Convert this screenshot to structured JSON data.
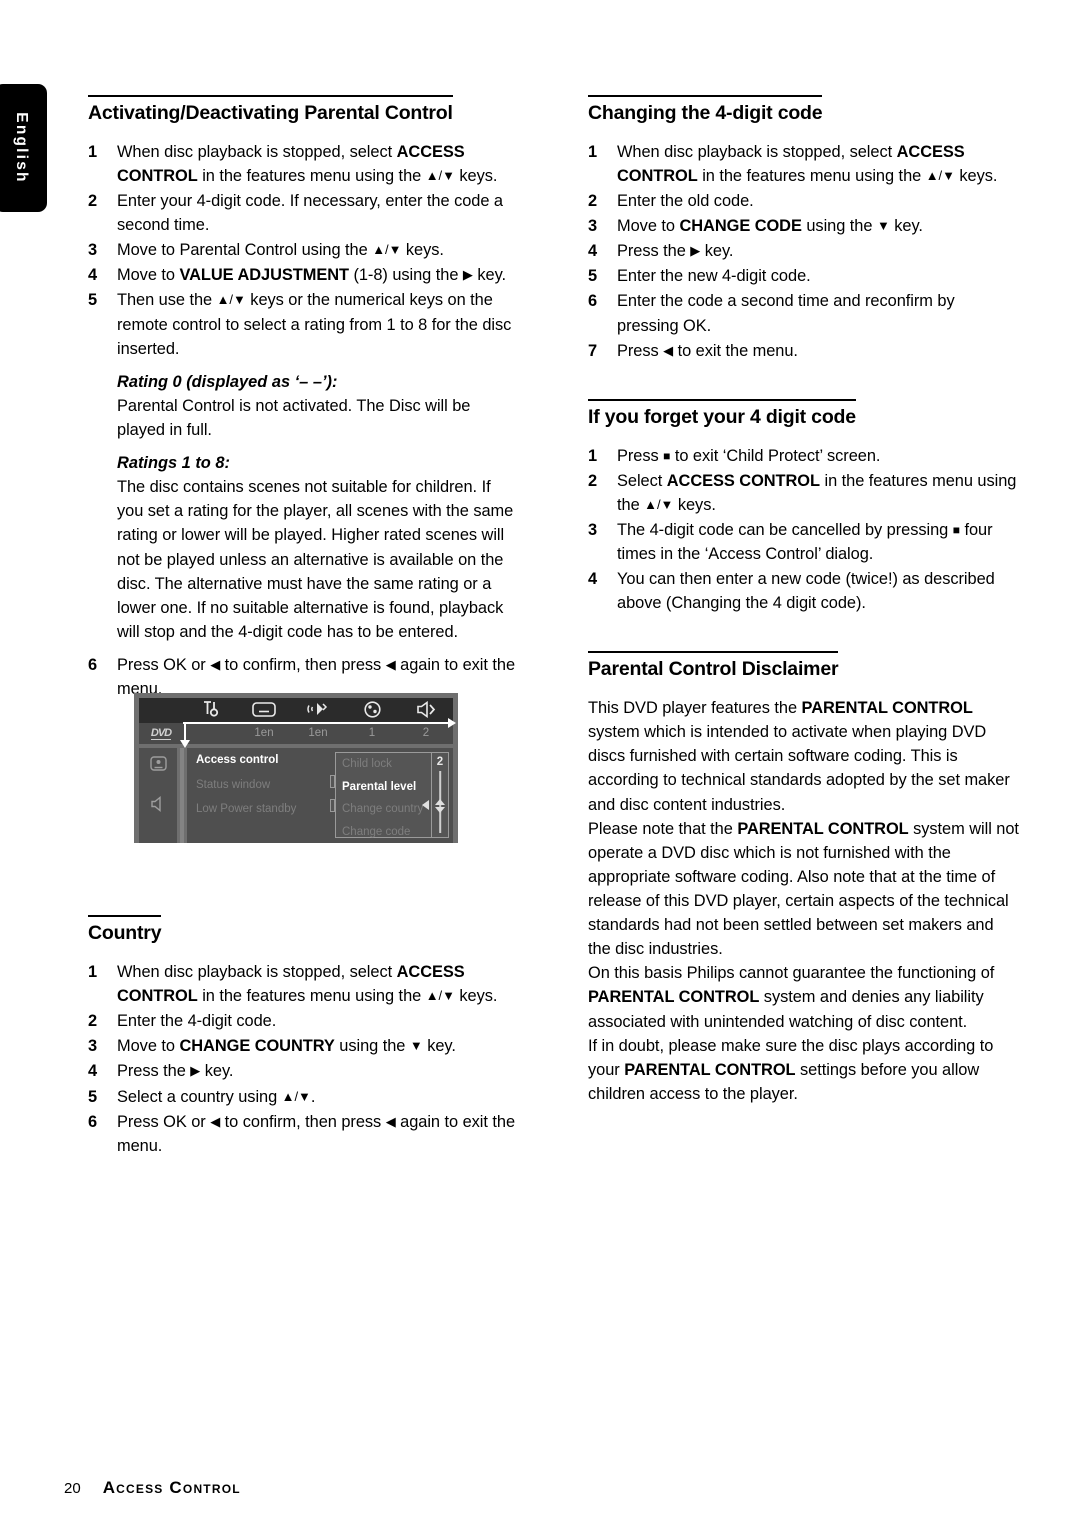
{
  "page": {
    "language_tab": "English",
    "footer_page_number": "20",
    "footer_title": "Access Control"
  },
  "left_column": {
    "section_parental": {
      "heading": "Activating/Deactivating Parental Control",
      "steps": [
        {
          "num": "1",
          "html": "When disc playback is stopped, select <b>ACCESS CONTROL</b> in the features menu using the <span class=\"kk\">▲/▼</span> keys."
        },
        {
          "num": "2",
          "html": "Enter your 4-digit code. If necessary, enter the code a second time."
        },
        {
          "num": "3",
          "html": "Move to Parental Control using the <span class=\"kk\">▲/▼</span> keys."
        },
        {
          "num": "4",
          "html": "Move to <b>VALUE ADJUSTMENT</b> (1-8) using the <span class=\"kk\">▶</span> key."
        },
        {
          "num": "5",
          "html": "Then use the <span class=\"kk\">▲/▼</span> keys or the numerical keys on the remote control to select a rating from 1 to 8 for the disc inserted."
        }
      ],
      "rating0_heading": "Rating 0 (displayed as ‘– –’):",
      "rating0_body": "Parental Control is not activated. The Disc will be played in full.",
      "ratings18_heading": "Ratings 1 to 8:",
      "ratings18_body": "The disc contains scenes not suitable for children. If you set a rating for the player, all scenes with the same rating or lower will be played. Higher rated scenes will not be played unless an alternative is available on the disc. The alternative must have the same rating or a lower one. If no suitable alternative is found, playback will stop and the 4-digit code has to be entered.",
      "final_step": {
        "num": "6",
        "html": "Press OK or <span class=\"kk\">◀</span> to confirm, then press <span class=\"kk\">◀</span> again to exit the menu."
      }
    },
    "tv_screenshot": {
      "top_bar": {
        "disc_label": "DVD",
        "items": [
          {
            "icon": "tools-icon",
            "value": ""
          },
          {
            "icon": "subtitle-icon",
            "value": "1en"
          },
          {
            "icon": "audio-language-icon",
            "value": "1en"
          },
          {
            "icon": "camera-angle-icon",
            "value": "1"
          },
          {
            "icon": "sound-icon",
            "value": "2"
          }
        ]
      },
      "sidebar_icons": [
        "picture-settings-icon",
        "speaker-icon"
      ],
      "menu_items": [
        {
          "label": "Access control",
          "selected": true
        },
        {
          "label": "Status window",
          "selected": false
        },
        {
          "label": "Low Power standby",
          "selected": false
        }
      ],
      "submenu_items": [
        {
          "label": "Child lock",
          "selected": false
        },
        {
          "label": "Parental level",
          "selected": true
        },
        {
          "label": "Change country",
          "selected": false
        },
        {
          "label": "Change code",
          "selected": false
        }
      ],
      "value": "2"
    },
    "section_country": {
      "heading": "Country",
      "steps": [
        {
          "num": "1",
          "html": "When disc playback is stopped, select <b>ACCESS CONTROL</b> in the features menu using the <span class=\"kk\">▲/▼</span> keys."
        },
        {
          "num": "2",
          "html": "Enter the 4-digit code."
        },
        {
          "num": "3",
          "html": "Move to <b>CHANGE COUNTRY</b> using the <span class=\"kk\">▼</span> key."
        },
        {
          "num": "4",
          "html": "Press the <span class=\"kk\">▶</span> key."
        },
        {
          "num": "5",
          "html": "Select a country using <span class=\"kk\">▲/▼</span>."
        },
        {
          "num": "6",
          "html": "Press OK or <span class=\"kk\">◀</span> to confirm, then press <span class=\"kk\">◀</span> again to exit the menu."
        }
      ]
    }
  },
  "right_column": {
    "section_changing_code": {
      "heading": "Changing the 4-digit code",
      "steps": [
        {
          "num": "1",
          "html": "When disc playback is stopped, select <b>ACCESS CONTROL</b> in the features menu using the <span class=\"kk\">▲/▼</span> keys."
        },
        {
          "num": "2",
          "html": "Enter the old code."
        },
        {
          "num": "3",
          "html": "Move to <b>CHANGE CODE</b> using the <span class=\"kk\">▼</span> key."
        },
        {
          "num": "4",
          "html": "Press the <span class=\"kk\">▶</span> key."
        },
        {
          "num": "5",
          "html": "Enter the new 4-digit code."
        },
        {
          "num": "6",
          "html": "Enter the code a second time and reconfirm by pressing OK."
        },
        {
          "num": "7",
          "html": "Press <span class=\"kk\">◀</span> to exit the menu."
        }
      ]
    },
    "section_forgot_code": {
      "heading": "If you forget your 4 digit code",
      "steps": [
        {
          "num": "1",
          "html": "Press <span class=\"sq\">■</span> to exit ‘Child Protect’ screen."
        },
        {
          "num": "2",
          "html": "Select <b>ACCESS CONTROL</b> in the features menu using the <span class=\"kk\">▲/▼</span> keys."
        },
        {
          "num": "3",
          "html": "The 4-digit code can be cancelled by pressing <span class=\"sq\">■</span> four times in the ‘Access Control’ dialog."
        },
        {
          "num": "4",
          "html": "You can then enter a new code (twice!) as described above (Changing the 4 digit code)."
        }
      ]
    },
    "section_disclaimer": {
      "heading": "Parental Control Disclaimer",
      "paragraphs": [
        "This DVD player features the <b>PARENTAL CONTROL</b> system which is intended to activate when playing DVD discs furnished with certain software coding. This is according to technical standards adopted by the set maker and disc content industries.",
        "Please note that the <b>PARENTAL CONTROL</b> system will not operate a DVD disc which is not furnished with the appropriate software coding. Also note that at the time of release of this DVD player, certain aspects of the technical standards had not been settled between set makers and the disc industries.",
        "On this basis Philips cannot guarantee the functioning of <b>PARENTAL CONTROL</b> system and denies any liability associated with unintended watching of disc content.",
        "If in doubt, please make sure the disc plays according to your <b>PARENTAL CONTROL</b> settings before you allow children access to the player."
      ]
    }
  }
}
